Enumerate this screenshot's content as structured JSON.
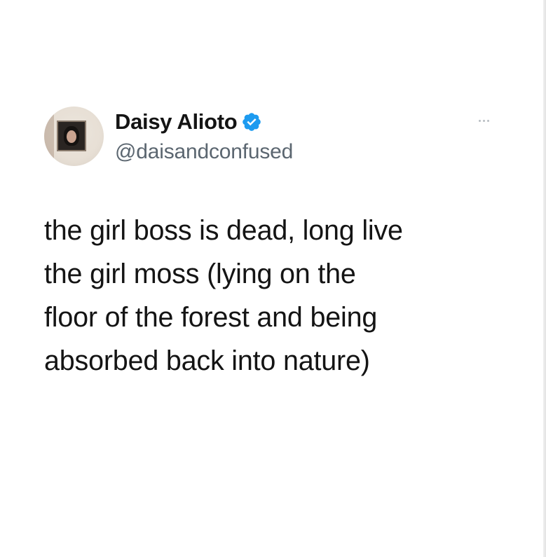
{
  "tweet": {
    "author": {
      "display_name": "Daisy Alioto",
      "handle": "@daisandconfused",
      "verified": true,
      "verified_icon": "verified-badge-icon",
      "avatar_icon": "avatar-photo"
    },
    "more_icon": "more-options-icon",
    "text_lines": [
      "the girl boss is dead, long live",
      "the girl moss (lying on the",
      "floor of the forest and being",
      "absorbed back into nature)"
    ]
  },
  "colors": {
    "background": "#ffffff",
    "name_text": "#141414",
    "handle_text": "#5b6670",
    "verified_badge": "#1d9bf0",
    "more_dots": "#b8bdc2"
  }
}
